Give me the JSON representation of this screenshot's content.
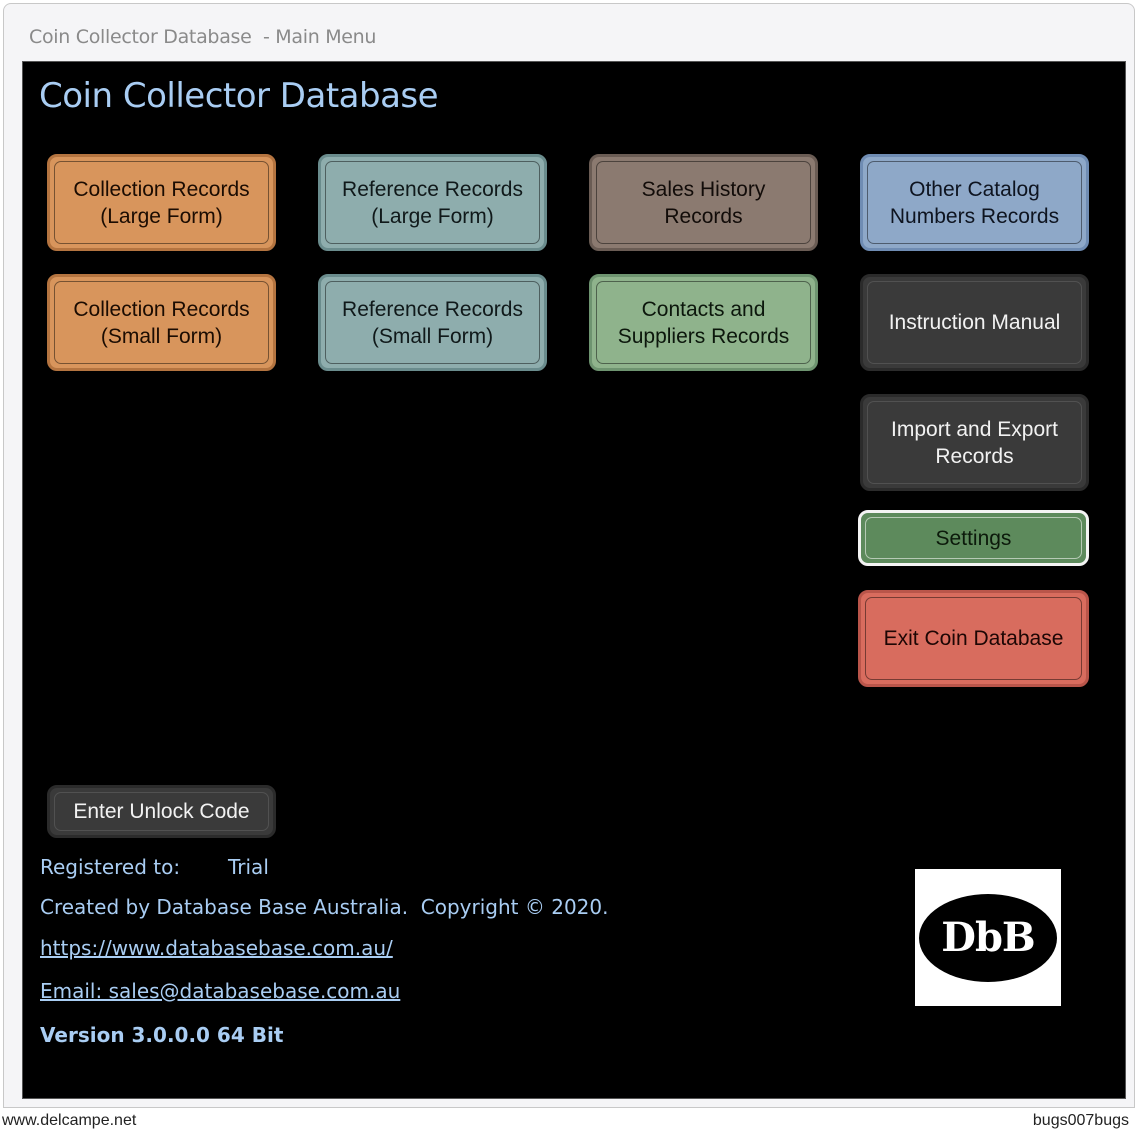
{
  "window": {
    "title": "Coin Collector Database  - Main Menu"
  },
  "app": {
    "title": "Coin Collector Database"
  },
  "buttons": {
    "collection_large": "Collection Records\n(Large Form)",
    "reference_large": "Reference Records\n(Large Form)",
    "sales_history": "Sales History\nRecords",
    "other_catalog": "Other Catalog\nNumbers Records",
    "collection_small": "Collection Records\n(Small Form)",
    "reference_small": "Reference Records\n(Small Form)",
    "contacts_suppliers": "Contacts and\nSuppliers Records",
    "instruction_manual": "Instruction Manual",
    "import_export": "Import and Export\nRecords",
    "settings": "Settings",
    "exit": "Exit Coin Database",
    "unlock": "Enter Unlock Code"
  },
  "info": {
    "registered_label": "Registered to:",
    "registered_value": "Trial",
    "created_by": "Created by Database Base Australia.  Copyright © 2020.",
    "website": "https://www.databasebase.com.au/",
    "email": "Email: sales@databasebase.com.au",
    "version": "Version 3.0.0.0 64 Bit"
  },
  "logo": {
    "text": "DbB",
    "icon": "dbb-logo"
  },
  "watermark": {
    "left": "www.delcampe.net",
    "right": "bugs007bugs"
  },
  "colors": {
    "background": "#000000",
    "title_text": "#a9cdf3",
    "collection": "#d8955c",
    "reference": "#8eadad",
    "sales": "#8b7a70",
    "catalog": "#8ea8c8",
    "contacts": "#8fb38c",
    "dark": "#3a3a3a",
    "settings": "#5d8a5c",
    "exit": "#d86c5e"
  }
}
